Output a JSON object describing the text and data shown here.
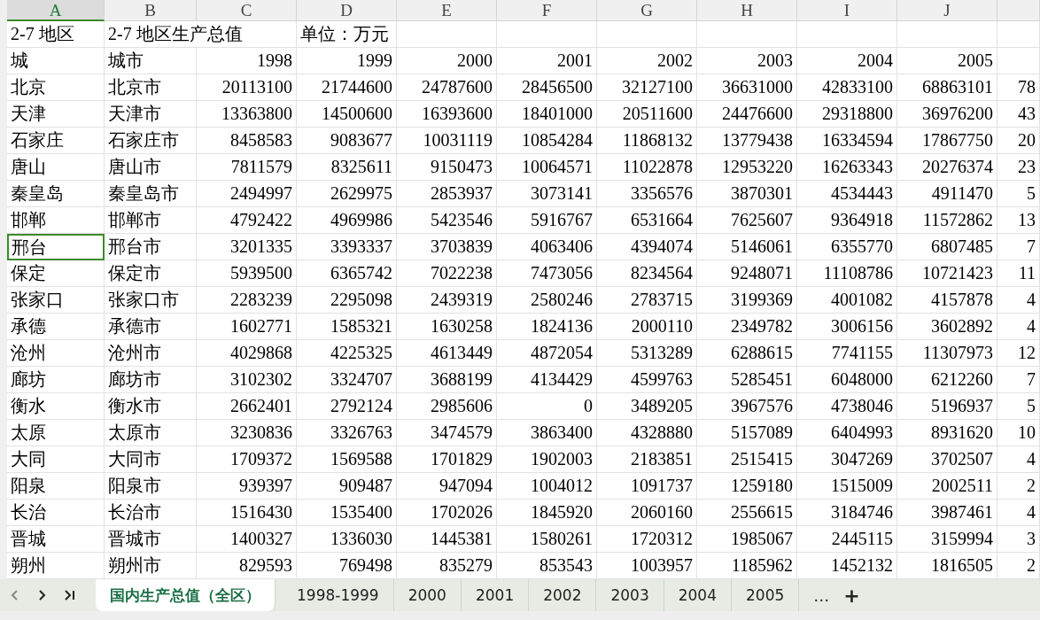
{
  "columns": [
    {
      "label": "A",
      "selected": true
    },
    {
      "label": "B",
      "selected": false
    },
    {
      "label": "C",
      "selected": false
    },
    {
      "label": "D",
      "selected": false
    },
    {
      "label": "E",
      "selected": false
    },
    {
      "label": "F",
      "selected": false
    },
    {
      "label": "G",
      "selected": false
    },
    {
      "label": "H",
      "selected": false
    },
    {
      "label": "I",
      "selected": false
    },
    {
      "label": "J",
      "selected": false
    }
  ],
  "title_row": {
    "column_a": "2-7 地区",
    "column_b": "2-7 地区生产总值",
    "column_d": "单位：万元"
  },
  "header_row": [
    "城",
    "城市",
    "1998",
    "1999",
    "2000",
    "2001",
    "2002",
    "2003",
    "2004",
    "2005"
  ],
  "rows": [
    {
      "selected": false,
      "cells": [
        "北京",
        "北京市",
        "20113100",
        "21744600",
        "24787600",
        "28456500",
        "32127100",
        "36631000",
        "42833100",
        "68863101",
        "78"
      ]
    },
    {
      "selected": false,
      "cells": [
        "天津",
        "天津市",
        "13363800",
        "14500600",
        "16393600",
        "18401000",
        "20511600",
        "24476600",
        "29318800",
        "36976200",
        "43"
      ]
    },
    {
      "selected": false,
      "cells": [
        "石家庄",
        "石家庄市",
        "8458583",
        "9083677",
        "10031119",
        "10854284",
        "11868132",
        "13779438",
        "16334594",
        "17867750",
        "20"
      ]
    },
    {
      "selected": false,
      "cells": [
        "唐山",
        "唐山市",
        "7811579",
        "8325611",
        "9150473",
        "10064571",
        "11022878",
        "12953220",
        "16263343",
        "20276374",
        "23"
      ]
    },
    {
      "selected": false,
      "cells": [
        "秦皇岛",
        "秦皇岛市",
        "2494997",
        "2629975",
        "2853937",
        "3073141",
        "3356576",
        "3870301",
        "4534443",
        "4911470",
        "5"
      ]
    },
    {
      "selected": false,
      "cells": [
        "邯郸",
        "邯郸市",
        "4792422",
        "4969986",
        "5423546",
        "5916767",
        "6531664",
        "7625607",
        "9364918",
        "11572862",
        "13"
      ]
    },
    {
      "selected": true,
      "cells": [
        "邢台",
        "邢台市",
        "3201335",
        "3393337",
        "3703839",
        "4063406",
        "4394074",
        "5146061",
        "6355770",
        "6807485",
        "7"
      ]
    },
    {
      "selected": false,
      "cells": [
        "保定",
        "保定市",
        "5939500",
        "6365742",
        "7022238",
        "7473056",
        "8234564",
        "9248071",
        "11108786",
        "10721423",
        "11"
      ]
    },
    {
      "selected": false,
      "cells": [
        "张家口",
        "张家口市",
        "2283239",
        "2295098",
        "2439319",
        "2580246",
        "2783715",
        "3199369",
        "4001082",
        "4157878",
        "4"
      ]
    },
    {
      "selected": false,
      "cells": [
        "承德",
        "承德市",
        "1602771",
        "1585321",
        "1630258",
        "1824136",
        "2000110",
        "2349782",
        "3006156",
        "3602892",
        "4"
      ]
    },
    {
      "selected": false,
      "cells": [
        "沧州",
        "沧州市",
        "4029868",
        "4225325",
        "4613449",
        "4872054",
        "5313289",
        "6288615",
        "7741155",
        "11307973",
        "12"
      ]
    },
    {
      "selected": false,
      "cells": [
        "廊坊",
        "廊坊市",
        "3102302",
        "3324707",
        "3688199",
        "4134429",
        "4599763",
        "5285451",
        "6048000",
        "6212260",
        "7"
      ]
    },
    {
      "selected": false,
      "cells": [
        "衡水",
        "衡水市",
        "2662401",
        "2792124",
        "2985606",
        "0",
        "3489205",
        "3967576",
        "4738046",
        "5196937",
        "5"
      ]
    },
    {
      "selected": false,
      "cells": [
        "太原",
        "太原市",
        "3230836",
        "3326763",
        "3474579",
        "3863400",
        "4328880",
        "5157089",
        "6404993",
        "8931620",
        "10"
      ]
    },
    {
      "selected": false,
      "cells": [
        "大同",
        "大同市",
        "1709372",
        "1569588",
        "1701829",
        "1902003",
        "2183851",
        "2515415",
        "3047269",
        "3702507",
        "4"
      ]
    },
    {
      "selected": false,
      "cells": [
        "阳泉",
        "阳泉市",
        "939397",
        "909487",
        "947094",
        "1004012",
        "1091737",
        "1259180",
        "1515009",
        "2002511",
        "2"
      ]
    },
    {
      "selected": false,
      "cells": [
        "长治",
        "长治市",
        "1516430",
        "1535400",
        "1702026",
        "1845920",
        "2060160",
        "2556615",
        "3184746",
        "3987461",
        "4"
      ]
    },
    {
      "selected": false,
      "cells": [
        "晋城",
        "晋城市",
        "1400327",
        "1336030",
        "1445381",
        "1580261",
        "1720312",
        "1985067",
        "2445115",
        "3159994",
        "3"
      ]
    },
    {
      "selected": false,
      "cells": [
        "朔州",
        "朔州市",
        "829593",
        "769498",
        "835279",
        "853543",
        "1003957",
        "1185962",
        "1452132",
        "1816505",
        "2"
      ]
    }
  ],
  "sheet_tabs": [
    {
      "label": "国内生产总值（全区）",
      "selected": true
    },
    {
      "label": "1998-1999",
      "selected": false
    },
    {
      "label": "2000",
      "selected": false
    },
    {
      "label": "2001",
      "selected": false
    },
    {
      "label": "2002",
      "selected": false
    },
    {
      "label": "2003",
      "selected": false
    },
    {
      "label": "2004",
      "selected": false
    },
    {
      "label": "2005",
      "selected": false
    }
  ],
  "more_tabs": "…",
  "add_sheet": "+"
}
